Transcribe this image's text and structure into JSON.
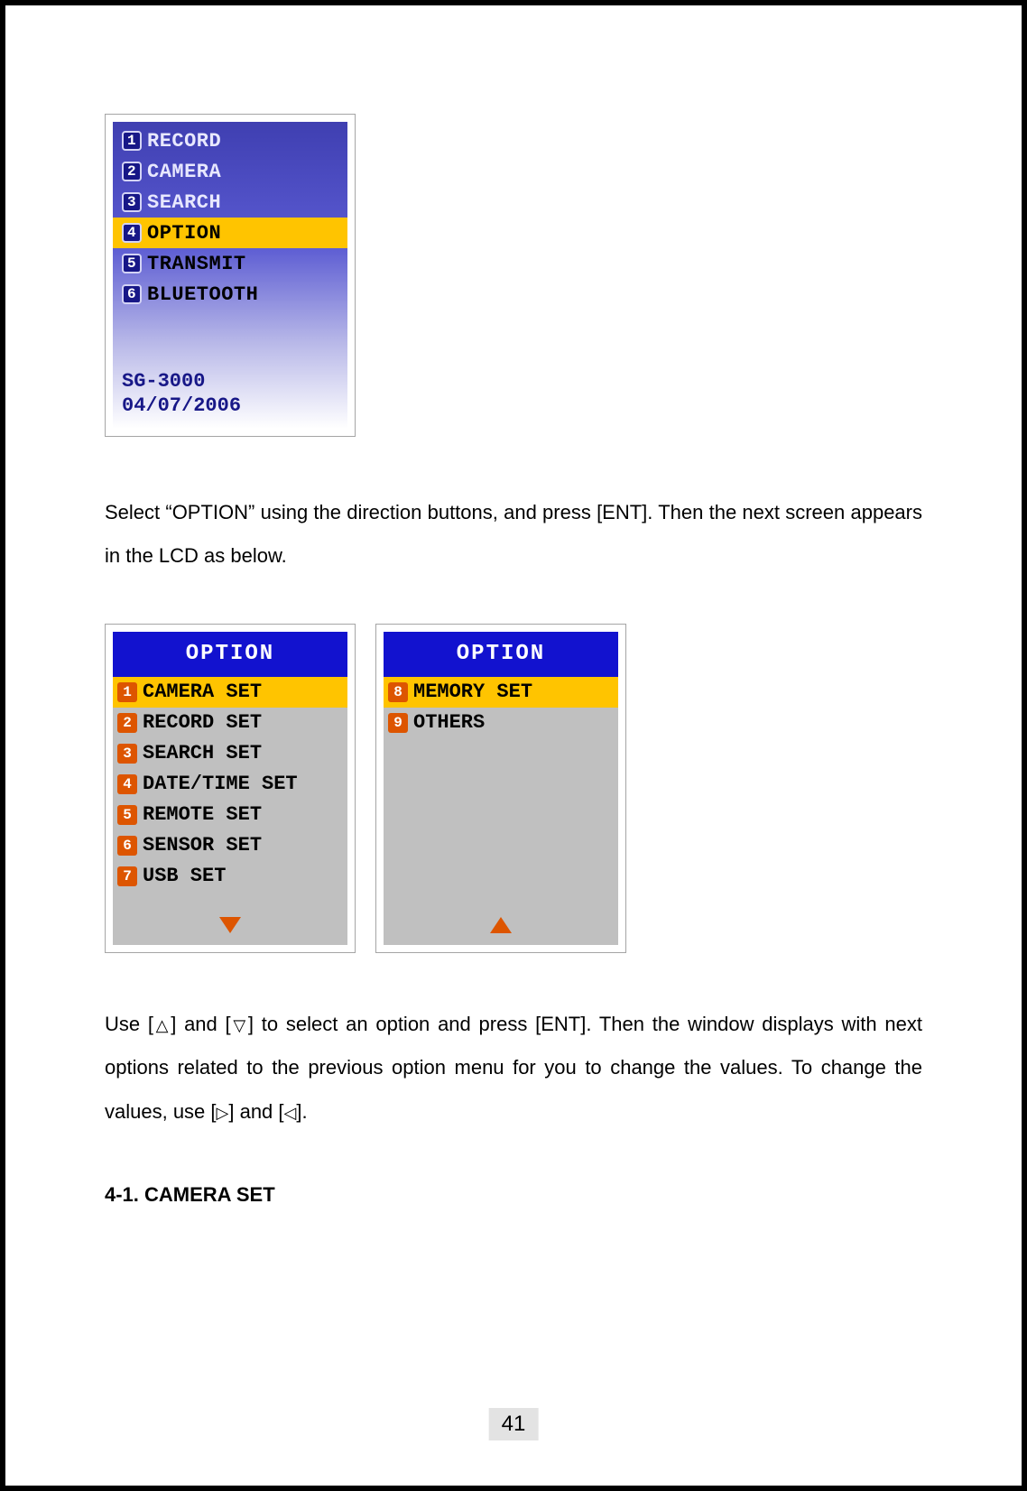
{
  "main_menu": {
    "items": [
      {
        "num": "1",
        "label": "RECORD"
      },
      {
        "num": "2",
        "label": "CAMERA"
      },
      {
        "num": "3",
        "label": "SEARCH"
      },
      {
        "num": "4",
        "label": "OPTION"
      },
      {
        "num": "5",
        "label": "TRANSMIT"
      },
      {
        "num": "6",
        "label": "BLUETOOTH"
      }
    ],
    "selected_index": 3,
    "model": "SG-3000",
    "date": "04/07/2006"
  },
  "para1": "Select “OPTION” using the direction buttons, and press [ENT]. Then the next screen appears in the LCD as below.",
  "option_screens": {
    "title": "OPTION",
    "left": {
      "items": [
        {
          "num": "1",
          "label": "CAMERA SET"
        },
        {
          "num": "2",
          "label": "RECORD SET"
        },
        {
          "num": "3",
          "label": "SEARCH SET"
        },
        {
          "num": "4",
          "label": "DATE/TIME SET"
        },
        {
          "num": "5",
          "label": "REMOTE SET"
        },
        {
          "num": "6",
          "label": "SENSOR SET"
        },
        {
          "num": "7",
          "label": "USB SET"
        }
      ],
      "selected_index": 0,
      "arrow": "down"
    },
    "right": {
      "items": [
        {
          "num": "8",
          "label": "MEMORY SET"
        },
        {
          "num": "9",
          "label": "OTHERS"
        }
      ],
      "selected_index": 0,
      "arrow": "up"
    }
  },
  "para2_a": "Use [",
  "para2_up": "△",
  "para2_b": "] and [",
  "para2_down": "▽",
  "para2_c": "] to select an option and press [ENT]. Then the window displays with next options related to the previous option menu for you to change the values. To change the values, use [",
  "para2_right": "▷",
  "para2_d": "] and [",
  "para2_left": "◁",
  "para2_e": "].",
  "heading_41": "4-1. CAMERA SET",
  "page_num": "41"
}
